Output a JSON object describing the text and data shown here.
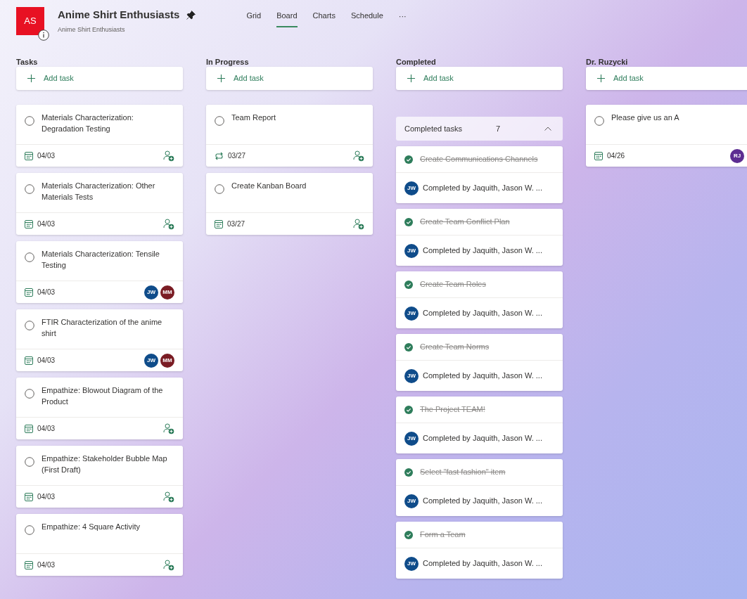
{
  "plan": {
    "initials": "AS",
    "title": "Anime Shirt Enthusiasts",
    "subtitle": "Anime Shirt Enthusiasts",
    "pinned": true
  },
  "tabs": [
    {
      "label": "Grid",
      "selected": false
    },
    {
      "label": "Board",
      "selected": true
    },
    {
      "label": "Charts",
      "selected": false
    },
    {
      "label": "Schedule",
      "selected": false
    }
  ],
  "more": "···",
  "buckets": [
    {
      "title": "Tasks",
      "add_label": "Add task",
      "tasks": [
        {
          "title": "Materials Characterization: Degradation Testing",
          "kind": "calendar",
          "date": "04/03"
        },
        {
          "title": "Materials Characterization: Other Materials Tests",
          "kind": "calendar",
          "date": "04/03"
        },
        {
          "title": "Materials Characterization: Tensile Testing",
          "kind": "calendar",
          "date": "04/03",
          "assignees": [
            {
              "initials": "JW",
              "color": "#0f4c8a"
            },
            {
              "initials": "MM",
              "color": "#7a1c24"
            }
          ]
        },
        {
          "title": "FTIR Characterization of the anime shirt",
          "kind": "calendar",
          "date": "04/03",
          "assignees": [
            {
              "initials": "JW",
              "color": "#0f4c8a"
            },
            {
              "initials": "MM",
              "color": "#7a1c24"
            }
          ]
        },
        {
          "title": "Empathize: Blowout Diagram of the Product",
          "kind": "calendar",
          "date": "04/03"
        },
        {
          "title": "Empathize: Stakeholder Bubble Map (First Draft)",
          "kind": "calendar",
          "date": "04/03"
        },
        {
          "title": "Empathize: 4 Square Activity",
          "kind": "calendar",
          "date": "04/03"
        }
      ]
    },
    {
      "title": "In Progress",
      "add_label": "Add task",
      "tasks": [
        {
          "title": "Team Report",
          "kind": "repeat",
          "date": "03/27"
        },
        {
          "title": "Create Kanban Board",
          "kind": "calendar",
          "date": "03/27"
        }
      ]
    },
    {
      "title": "Completed",
      "add_label": "Add task",
      "completed": {
        "label": "Completed tasks",
        "count": "7",
        "expanded": true,
        "tasks": [
          {
            "title": "Create Communications Channels",
            "initials": "JW",
            "color": "#0f4c8a",
            "completed_by": "Completed by Jaquith, Jason W. ..."
          },
          {
            "title": "Create Team Conflict Plan",
            "initials": "JW",
            "color": "#0f4c8a",
            "completed_by": "Completed by Jaquith, Jason W. ..."
          },
          {
            "title": "Create Team Roles",
            "initials": "JW",
            "color": "#0f4c8a",
            "completed_by": "Completed by Jaquith, Jason W. ..."
          },
          {
            "title": "Create Team Norms",
            "initials": "JW",
            "color": "#0f4c8a",
            "completed_by": "Completed by Jaquith, Jason W. ..."
          },
          {
            "title": "The Project TEAM!",
            "initials": "JW",
            "color": "#0f4c8a",
            "completed_by": "Completed by Jaquith, Jason W. ..."
          },
          {
            "title": "Select \"fast fashion\" item",
            "initials": "JW",
            "color": "#0f4c8a",
            "completed_by": "Completed by Jaquith, Jason W. ..."
          },
          {
            "title": "Form a Team",
            "initials": "JW",
            "color": "#0f4c8a",
            "completed_by": "Completed by Jaquith, Jason W. ..."
          }
        ]
      }
    },
    {
      "title": "Dr. Ruzycki",
      "add_label": "Add task",
      "tasks": [
        {
          "title": "Please give us an A",
          "kind": "calendar",
          "date": "04/26",
          "assignees": [
            {
              "initials": "RJ",
              "color": "#5c2d91"
            }
          ]
        }
      ]
    }
  ]
}
